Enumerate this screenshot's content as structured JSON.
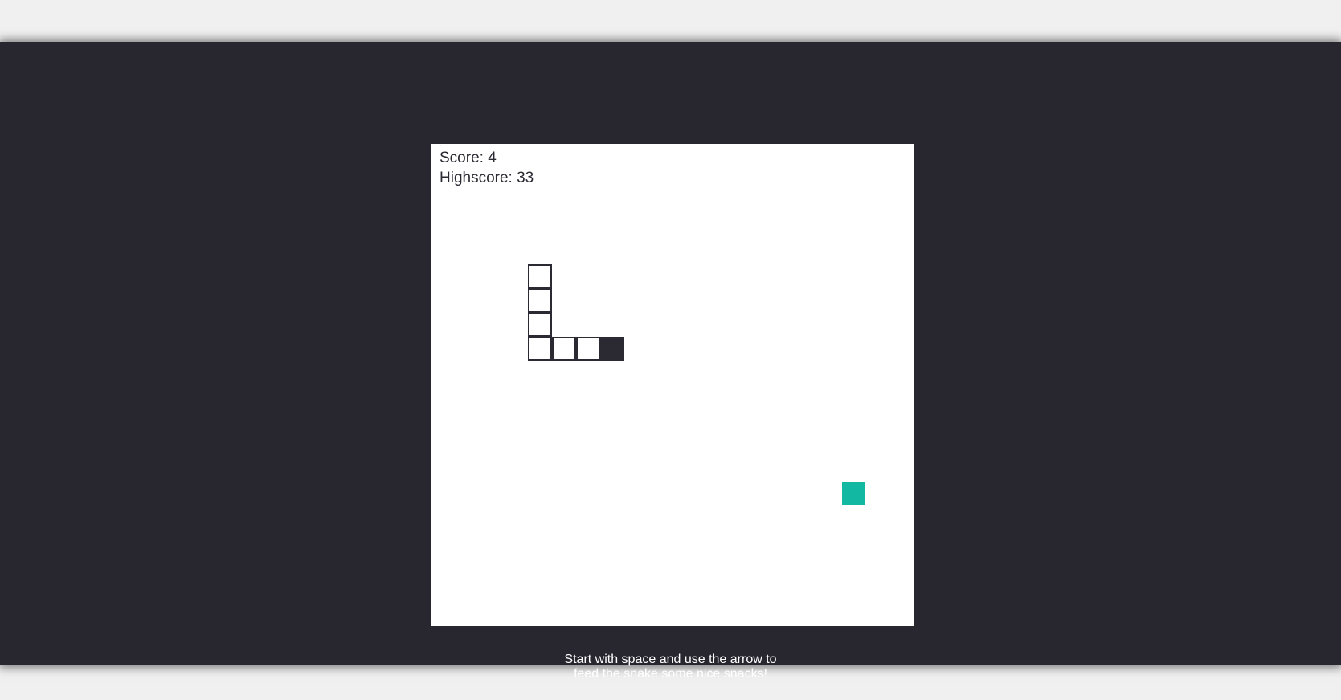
{
  "game": {
    "score_text": "Score: 4",
    "highscore_text": "Highscore: 33",
    "score": 4,
    "highscore": 33
  },
  "instructions": {
    "line1": "Start with space and use the arrow to",
    "line2": "feed the snake some nice snacks!"
  },
  "colors": {
    "background": "#282730",
    "board": "#ffffff",
    "snake_outline": "#2b2a33",
    "snake_head": "#2b2a33",
    "food": "#13b8a2",
    "text_dark": "#2b2a33",
    "text_light": "#ffffff"
  },
  "grid": {
    "columns": 20,
    "rows": 20
  },
  "snake": {
    "segments": [
      {
        "col": 4,
        "row": 5
      },
      {
        "col": 4,
        "row": 6
      },
      {
        "col": 4,
        "row": 7
      },
      {
        "col": 4,
        "row": 8
      },
      {
        "col": 5,
        "row": 8
      },
      {
        "col": 6,
        "row": 8
      },
      {
        "col": 7,
        "row": 8
      }
    ],
    "head_index": 6
  },
  "food": {
    "col": 17,
    "row": 14
  }
}
